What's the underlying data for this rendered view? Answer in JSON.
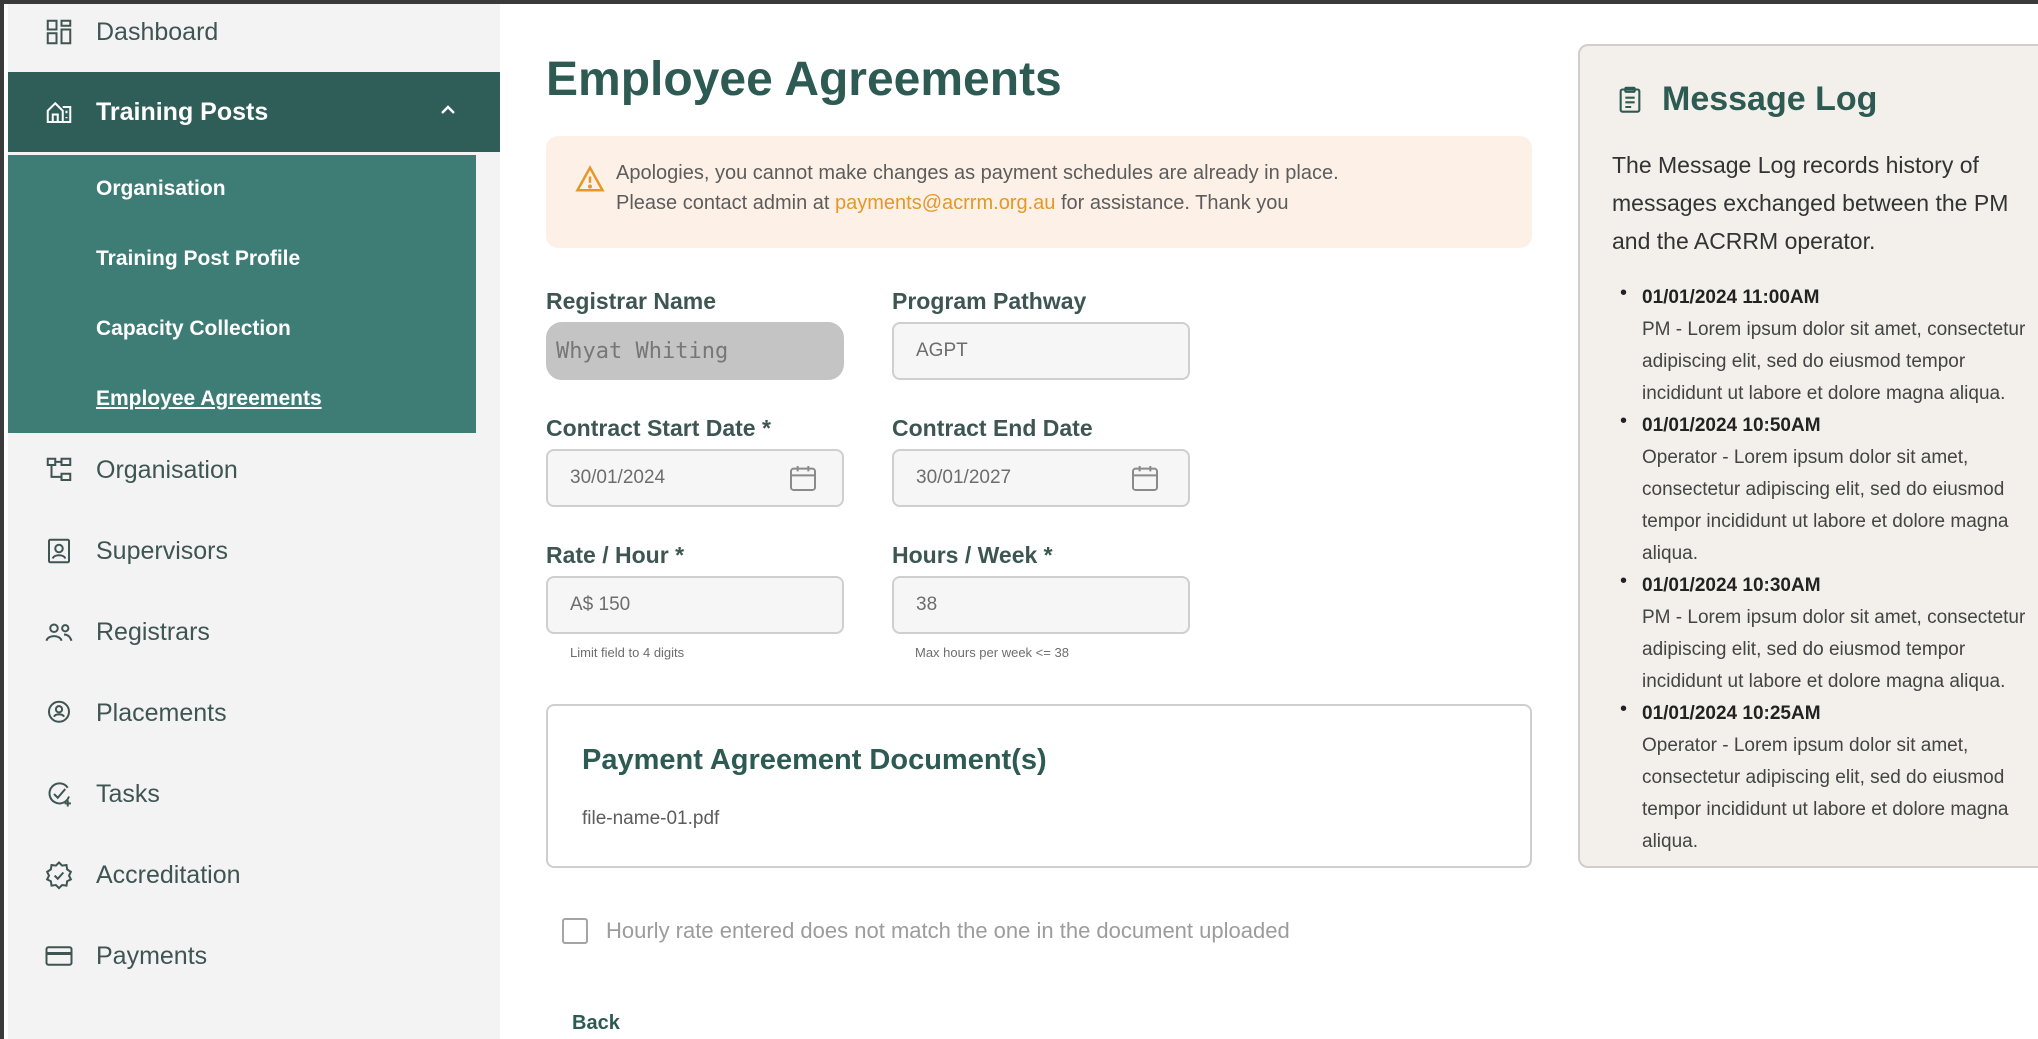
{
  "sidebar": {
    "items": [
      {
        "label": "Dashboard",
        "icon": "dashboard-icon"
      },
      {
        "label": "Training Posts",
        "icon": "building-icon",
        "active": true
      },
      {
        "label": "Organisation",
        "icon": "org-chart-icon"
      },
      {
        "label": "Supervisors",
        "icon": "id-badge-icon"
      },
      {
        "label": "Registrars",
        "icon": "users-icon"
      },
      {
        "label": "Placements",
        "icon": "location-pin-icon"
      },
      {
        "label": "Tasks",
        "icon": "task-check-icon"
      },
      {
        "label": "Accreditation",
        "icon": "accreditation-icon"
      },
      {
        "label": "Payments",
        "icon": "card-icon"
      }
    ],
    "subitems": [
      {
        "label": "Organisation"
      },
      {
        "label": "Training Post Profile"
      },
      {
        "label": "Capacity Collection"
      },
      {
        "label": "Employee Agreements",
        "current": true
      }
    ]
  },
  "main": {
    "title": "Employee Agreements",
    "alert": {
      "line1": "Apologies, you cannot make changes as payment schedules are already in place.",
      "line2_prefix": "Please contact admin at ",
      "email": "payments@acrrm.org.au",
      "line2_suffix": " for assistance. Thank you"
    },
    "fields": {
      "registrar_name": {
        "label": "Registrar Name",
        "value": "Whyat Whiting"
      },
      "program_pathway": {
        "label": "Program Pathway",
        "value": "AGPT"
      },
      "contract_start": {
        "label": "Contract Start Date *",
        "value": "30/01/2024"
      },
      "contract_end": {
        "label": "Contract End Date",
        "value": "30/01/2027"
      },
      "rate": {
        "label": "Rate / Hour *",
        "value": "A$ 150",
        "hint": "Limit field to 4 digits"
      },
      "hours": {
        "label": "Hours / Week *",
        "value": "38",
        "hint": "Max hours per week <= 38"
      }
    },
    "documents": {
      "title": "Payment Agreement Document(s)",
      "file": "file-name-01.pdf"
    },
    "checkbox_label": "Hourly rate entered does not match the one in the document uploaded",
    "back_label": "Back"
  },
  "message_log": {
    "title": "Message Log",
    "description": "The Message Log records history of messages exchanged between the PM and the ACRRM operator.",
    "entries": [
      {
        "timestamp": "01/01/2024 11:00AM",
        "message": "PM - Lorem ipsum dolor sit amet, consectetur adipiscing elit, sed do eiusmod tempor incididunt ut labore et dolore magna aliqua."
      },
      {
        "timestamp": "01/01/2024 10:50AM",
        "message": "Operator - Lorem ipsum dolor sit amet, consectetur adipiscing elit, sed do eiusmod tempor incididunt ut labore et dolore magna aliqua."
      },
      {
        "timestamp": "01/01/2024 10:30AM",
        "message": "PM - Lorem ipsum dolor sit amet, consectetur adipiscing elit, sed do eiusmod tempor incididunt ut labore et dolore magna aliqua."
      },
      {
        "timestamp": "01/01/2024 10:25AM",
        "message": "Operator - Lorem ipsum dolor sit amet, consectetur adipiscing elit, sed do eiusmod tempor incididunt ut labore et dolore magna aliqua."
      }
    ]
  },
  "colors": {
    "sidebar_active": "#2f5e58",
    "sidebar_sub": "#3d7d76",
    "title": "#2d5a52",
    "alert_bg": "#fdf1e7",
    "alert_link": "#e59727"
  }
}
